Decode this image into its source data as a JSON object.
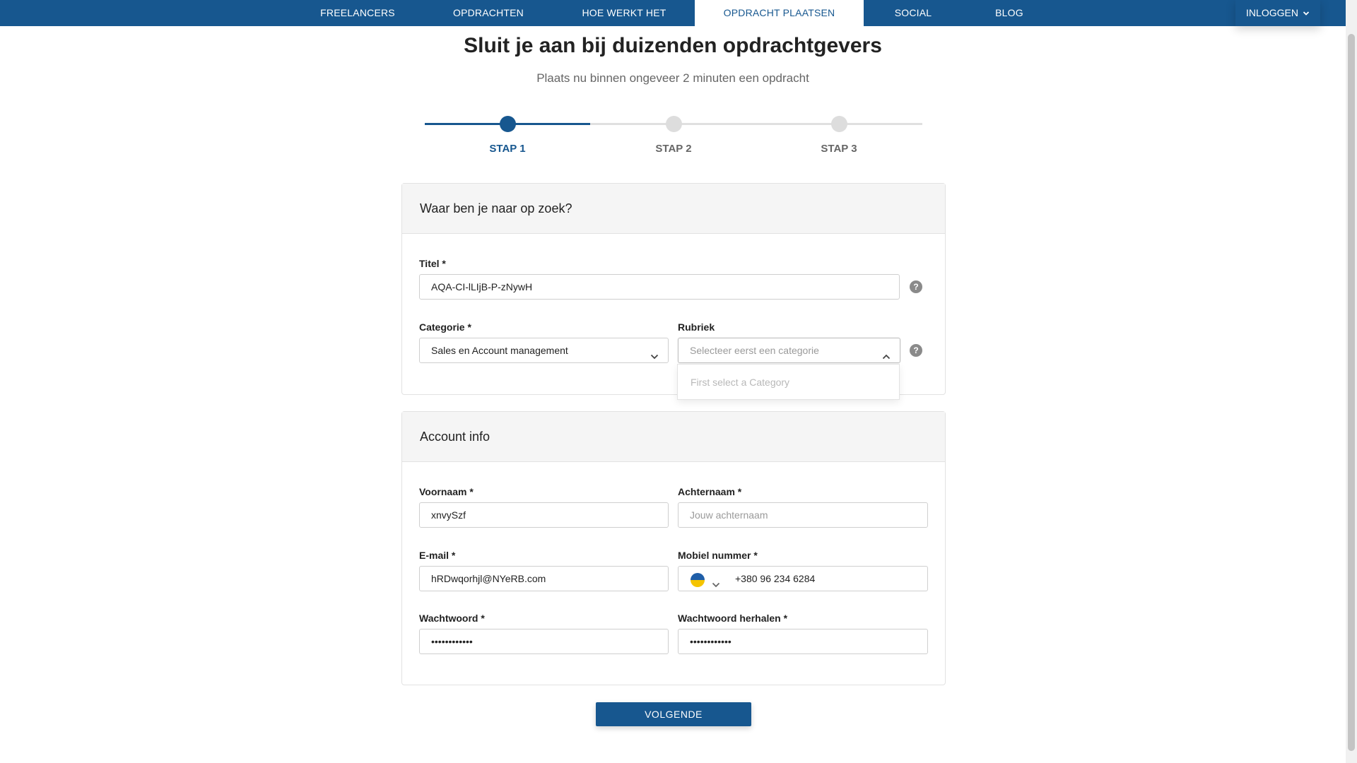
{
  "nav": {
    "items": [
      {
        "label": "FREELANCERS"
      },
      {
        "label": "OPDRACHTEN"
      },
      {
        "label": "HOE WERKT HET"
      },
      {
        "label": "OPDRACHT PLAATSEN",
        "active": true
      },
      {
        "label": "SOCIAL"
      },
      {
        "label": "BLOG"
      }
    ],
    "login_label": "INLOGGEN",
    "accent_color": "#17578f"
  },
  "header": {
    "title": "Sluit je aan bij duizenden opdrachtgevers",
    "subtitle": "Plaats nu binnen ongeveer 2 minuten een opdracht"
  },
  "stepper": {
    "steps": [
      {
        "label": "STAP 1",
        "active": true
      },
      {
        "label": "STAP 2",
        "active": false
      },
      {
        "label": "STAP 3",
        "active": false
      }
    ]
  },
  "search_card": {
    "title": "Waar ben je naar op zoek?",
    "titel_label": "Titel *",
    "titel_value": "AQA-CI-lLIjB-P-zNywH",
    "categorie_label": "Categorie *",
    "categorie_value": "Sales en Account management",
    "rubriek_label": "Rubriek",
    "rubriek_placeholder": "Selecteer eerst een categorie",
    "rubriek_dropdown_option": "First select a Category",
    "help_glyph": "?"
  },
  "account_card": {
    "title": "Account info",
    "voornaam_label": "Voornaam *",
    "voornaam_value": "xnvySzf",
    "achternaam_label": "Achternaam *",
    "achternaam_placeholder": "Jouw achternaam",
    "email_label": "E-mail *",
    "email_value": "hRDwqorhjl@NYeRB.com",
    "mobiel_label": "Mobiel nummer *",
    "mobiel_value": "+380 96 234 6284",
    "wachtwoord_label": "Wachtwoord *",
    "wachtwoord_value": "••••••••••••",
    "wachtwoord_herhalen_label": "Wachtwoord herhalen *",
    "wachtwoord_herhalen_value": "••••••••••••"
  },
  "actions": {
    "next_label": "VOLGENDE"
  }
}
